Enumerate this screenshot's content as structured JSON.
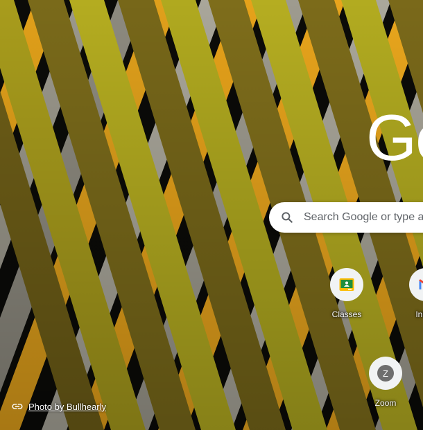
{
  "logo": {
    "text": "Go"
  },
  "search": {
    "placeholder": "Search Google or type a URL"
  },
  "shortcuts": [
    {
      "label": "Classes",
      "icon": "google-classroom-icon",
      "color": "#1e8e3e"
    },
    {
      "label": "Inbox",
      "icon": "gmail-icon",
      "color": "#ea4335"
    },
    {
      "label": "Zoom",
      "icon": "letter-z-icon",
      "letter": "Z",
      "color": "#6e6e6e"
    }
  ],
  "attribution": {
    "text": "Photo by Bullhearly",
    "icon": "link-icon"
  },
  "colors": {
    "background": "#0b0b08",
    "stripe_gold": "#e6a21a",
    "stripe_olive": "#8f7a1d",
    "stripe_yellow": "#b7b21e",
    "stripe_grey": "#a9a69a"
  }
}
